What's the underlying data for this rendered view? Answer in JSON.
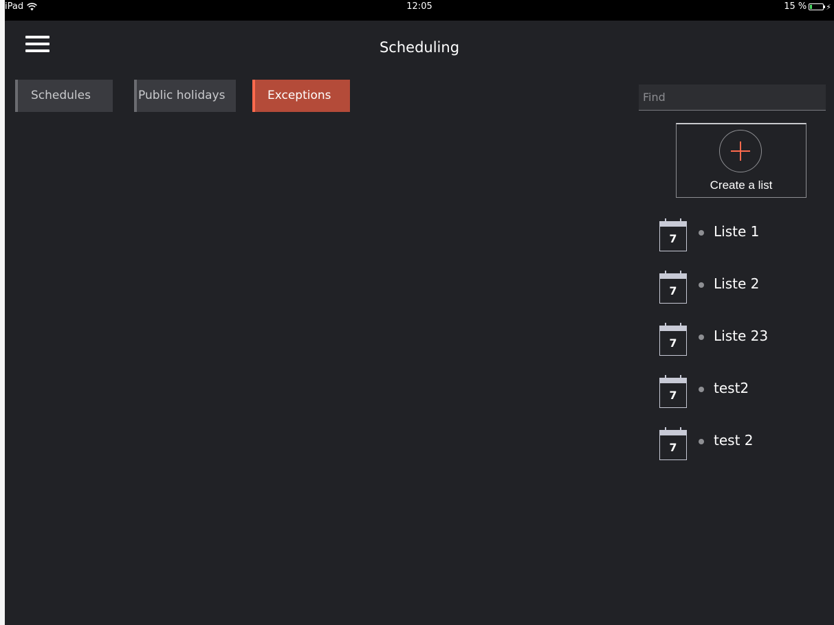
{
  "status_bar": {
    "device": "iPad",
    "time": "12:05",
    "battery": "15 %",
    "wifi_icon": "wifi-icon",
    "battery_icon": "battery-icon",
    "charging_icon": "bolt-icon"
  },
  "header": {
    "title": "Scheduling",
    "menu_icon": "hamburger-menu-icon"
  },
  "tabs": [
    {
      "label": "Schedules",
      "active": false
    },
    {
      "label": "Public holidays",
      "active": false
    },
    {
      "label": "Exceptions",
      "active": true
    }
  ],
  "search": {
    "placeholder": "Find",
    "value": ""
  },
  "create_list": {
    "label": "Create a list",
    "icon": "plus-icon"
  },
  "lists": {
    "icon": "calendar-icon",
    "icon_day": "7",
    "items": [
      {
        "name": "Liste 1"
      },
      {
        "name": "Liste 2"
      },
      {
        "name": "Liste 23"
      },
      {
        "name": "test2"
      },
      {
        "name": "test 2"
      }
    ]
  },
  "colors": {
    "background": "#212226",
    "tab_inactive": "#3a3b40",
    "tab_active": "#b44b39",
    "accent": "#ff6a4d",
    "text": "#ffffff"
  }
}
